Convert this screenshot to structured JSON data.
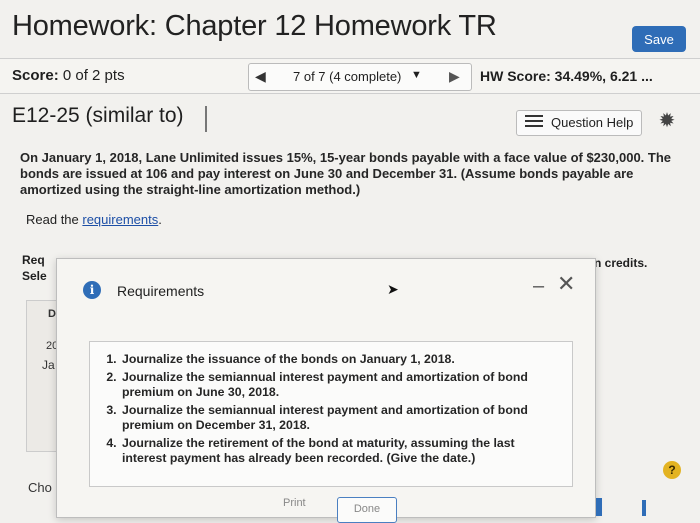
{
  "header": {
    "title": "Homework: Chapter 12 Homework TR",
    "save_label": "Save"
  },
  "score_bar": {
    "score_label": "Score:",
    "score_value": "0 of 2 pts",
    "question_nav": "7 of 7 (4 complete)",
    "hw_score": "HW Score: 34.49%, 6.21 ..."
  },
  "exercise": {
    "title": "E12-25 (similar to)",
    "help_label": "Question Help"
  },
  "problem": {
    "text": "On January 1, 2018, Lane Unlimited issues 15%, 15-year bonds payable with a face value of $230,000. The bonds are issued at 106 and pay interest on June 30 and December 31. (Assume bonds payable are amortized using the straight-line amortization method.)",
    "read_prefix": "Read the ",
    "read_link": "requirements",
    "read_suffix": "."
  },
  "background": {
    "req_line1": "Req",
    "req_line2": "Sele",
    "credits": "n credits.",
    "col_d": "D",
    "row_20": "20",
    "row_ja": "Ja",
    "choose": "Cho"
  },
  "modal": {
    "title": "Requirements",
    "items": [
      "Journalize the issuance of the bonds on January 1, 2018.",
      "Journalize the semiannual interest payment and amortization of bond premium on June 30, 2018.",
      "Journalize the semiannual interest payment and amortization of bond premium on December 31, 2018.",
      "Journalize the retirement of the bond at maturity, assuming the last interest payment has already been recorded. (Give the date.)"
    ],
    "print_label": "Print",
    "done_label": "Done"
  },
  "icons": {
    "info": "info-icon",
    "help": "list-icon",
    "settings": "gear-icon",
    "close": "close-icon",
    "minimize": "minimize-icon",
    "question": "question-icon"
  },
  "colors": {
    "accent": "#2f6db7",
    "link": "#1d4fa6",
    "help_badge": "#e3b322"
  }
}
